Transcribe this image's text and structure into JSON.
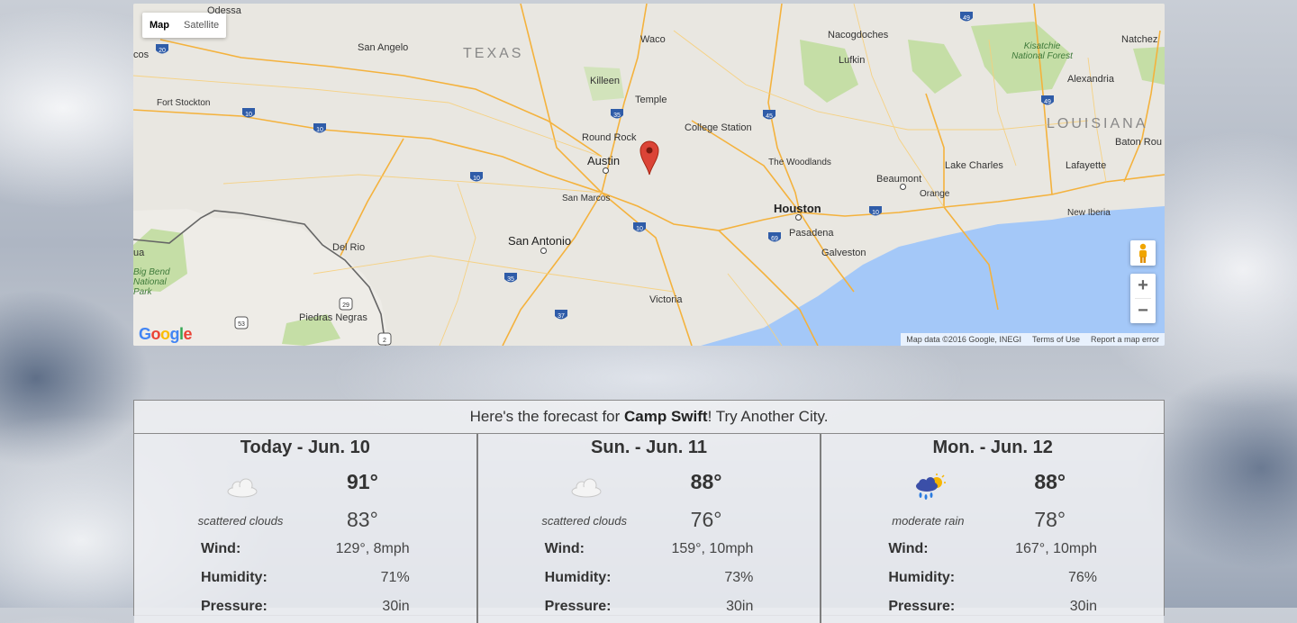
{
  "map": {
    "type_control": {
      "map": "Map",
      "satellite": "Satellite"
    },
    "labels": {
      "odessa": "Odessa",
      "san_angelo": "San Angelo",
      "texas": "TEXAS",
      "waco": "Waco",
      "nacogdoches": "Nacogdoches",
      "natchez": "Natchez",
      "kisatchie": "Kisatchie National Forest",
      "lufkin": "Lufkin",
      "alexandria": "Alexandria",
      "louisiana": "LOUISIANA",
      "fort_stockton": "Fort Stockton",
      "killeen": "Killeen",
      "temple": "Temple",
      "college_station": "College Station",
      "round_rock": "Round Rock",
      "austin": "Austin",
      "baton_rouge": "Baton Rou",
      "the_woodlands": "The Woodlands",
      "lake_charles": "Lake Charles",
      "lafayette": "Lafayette",
      "beaumont": "Beaumont",
      "orange": "Orange",
      "new_iberia": "New Iberia",
      "san_marcos": "San Marcos",
      "houston": "Houston",
      "pasadena": "Pasadena",
      "del_rio": "Del Rio",
      "san_antonio": "San Antonio",
      "galveston": "Galveston",
      "big_bend": "Big Bend National Park",
      "victoria": "Victoria",
      "piedras_negras": "Piedras Negras",
      "cos": "cos",
      "ua": "ua"
    },
    "shields": [
      "20",
      "10",
      "10",
      "35",
      "45",
      "49",
      "49",
      "10",
      "10",
      "69",
      "10",
      "35",
      "37",
      "29",
      "53",
      "2"
    ],
    "footer": {
      "data": "Map data ©2016 Google, INEGI",
      "terms": "Terms of Use",
      "report": "Report a map error"
    },
    "logo": "Google",
    "zoom_in": "+",
    "zoom_out": "−"
  },
  "forecast": {
    "prefix": "Here's the forecast for ",
    "city": "Camp Swift",
    "suffix": "! Try Another City.",
    "days": [
      {
        "title": "Today - Jun. 10",
        "icon": "cloud-icon",
        "desc": "scattered clouds",
        "hi": "91°",
        "lo": "83°",
        "wind": "129°, 8mph",
        "humidity": "71%",
        "pressure": "30in"
      },
      {
        "title": "Sun. - Jun. 11",
        "icon": "cloud-icon",
        "desc": "scattered clouds",
        "hi": "88°",
        "lo": "76°",
        "wind": "159°, 10mph",
        "humidity": "73%",
        "pressure": "30in"
      },
      {
        "title": "Mon. - Jun. 12",
        "icon": "rain-sun-icon",
        "desc": "moderate rain",
        "hi": "88°",
        "lo": "78°",
        "wind": "167°, 10mph",
        "humidity": "76%",
        "pressure": "30in"
      }
    ],
    "labels": {
      "wind": "Wind:",
      "humidity": "Humidity:",
      "pressure": "Pressure:"
    }
  },
  "colors": {
    "marker": "#db4437",
    "water": "#a4c8f8",
    "road": "#f6b73c",
    "park": "#c5dea6"
  }
}
